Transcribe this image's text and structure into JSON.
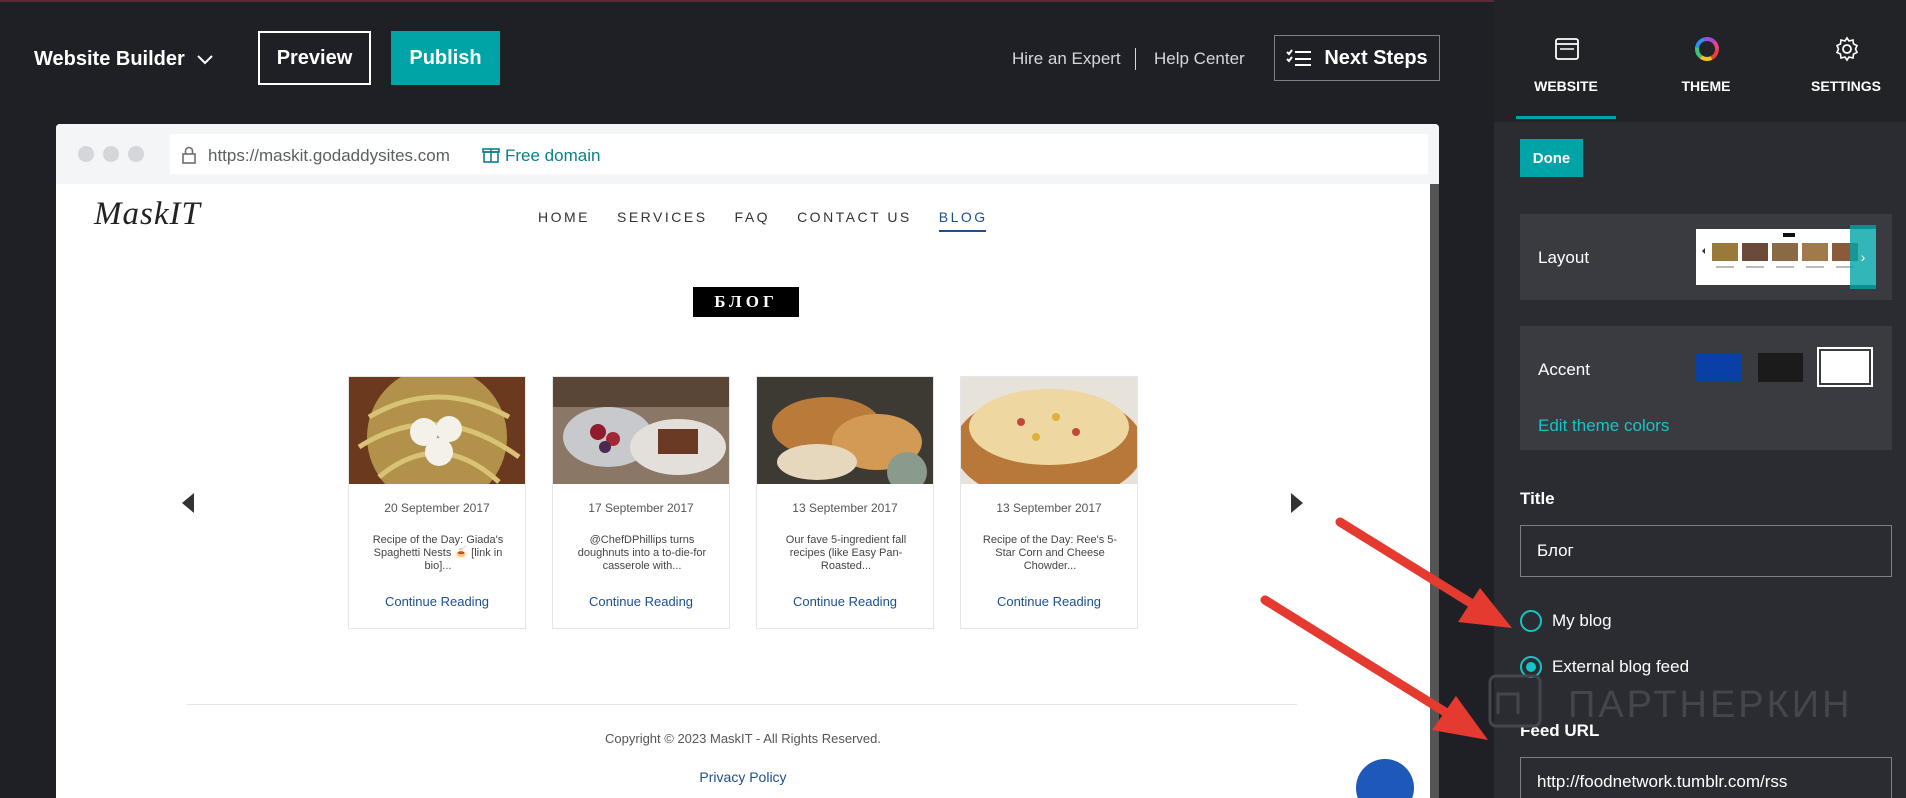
{
  "app": {
    "name": "Website Builder",
    "preview_label": "Preview",
    "publish_label": "Publish",
    "hire_label": "Hire an Expert",
    "help_label": "Help Center",
    "next_steps_label": "Next Steps"
  },
  "browser": {
    "url": "https://maskit.godaddysites.com",
    "free_domain_label": "Free domain"
  },
  "site": {
    "logo": "MaskIT",
    "nav": [
      "HOME",
      "SERVICES",
      "FAQ",
      "CONTACT US",
      "BLOG"
    ],
    "active_nav": "BLOG",
    "blog_title": "БЛОГ",
    "posts": [
      {
        "date": "20 September 2017",
        "excerpt": "Recipe of the Day: Giada's Spaghetti Nests 🍝 [link in bio]...",
        "more": "Continue Reading"
      },
      {
        "date": "17 September 2017",
        "excerpt": "@ChefDPhillips turns doughnuts into a to-die-for casserole with...",
        "more": "Continue Reading"
      },
      {
        "date": "13 September 2017",
        "excerpt": "Our fave 5-ingredient fall recipes (like Easy Pan-Roasted...",
        "more": "Continue Reading"
      },
      {
        "date": "13 September 2017",
        "excerpt": "Recipe of the Day: Ree's 5-Star Corn and Cheese Chowder...",
        "more": "Continue Reading"
      }
    ],
    "copyright": "Copyright © 2023 MaskIT - All Rights Reserved.",
    "privacy": "Privacy Policy"
  },
  "panel": {
    "tabs": [
      {
        "label": "WEBSITE",
        "icon": "browser-window-icon"
      },
      {
        "label": "THEME",
        "icon": "color-wheel-icon"
      },
      {
        "label": "SETTINGS",
        "icon": "gear-icon"
      }
    ],
    "active_tab": "WEBSITE",
    "done_label": "Done",
    "layout_label": "Layout",
    "accent_label": "Accent",
    "accent_colors": [
      "#0a3fa6",
      "#1b1b1b",
      "#ffffff"
    ],
    "edit_theme_label": "Edit theme colors",
    "title_label": "Title",
    "title_value": "Блог",
    "radio_options": [
      {
        "label": "My blog",
        "checked": false
      },
      {
        "label": "External blog feed",
        "checked": true
      }
    ],
    "feed_label": "Feed URL",
    "feed_value": "http://foodnetwork.tumblr.com/rss"
  },
  "watermark": "ПАРТНЕРКИН",
  "colors": {
    "accent_teal": "#00a4a6",
    "link_blue": "#1e4f8f",
    "annotation_red": "#e53a2f"
  }
}
